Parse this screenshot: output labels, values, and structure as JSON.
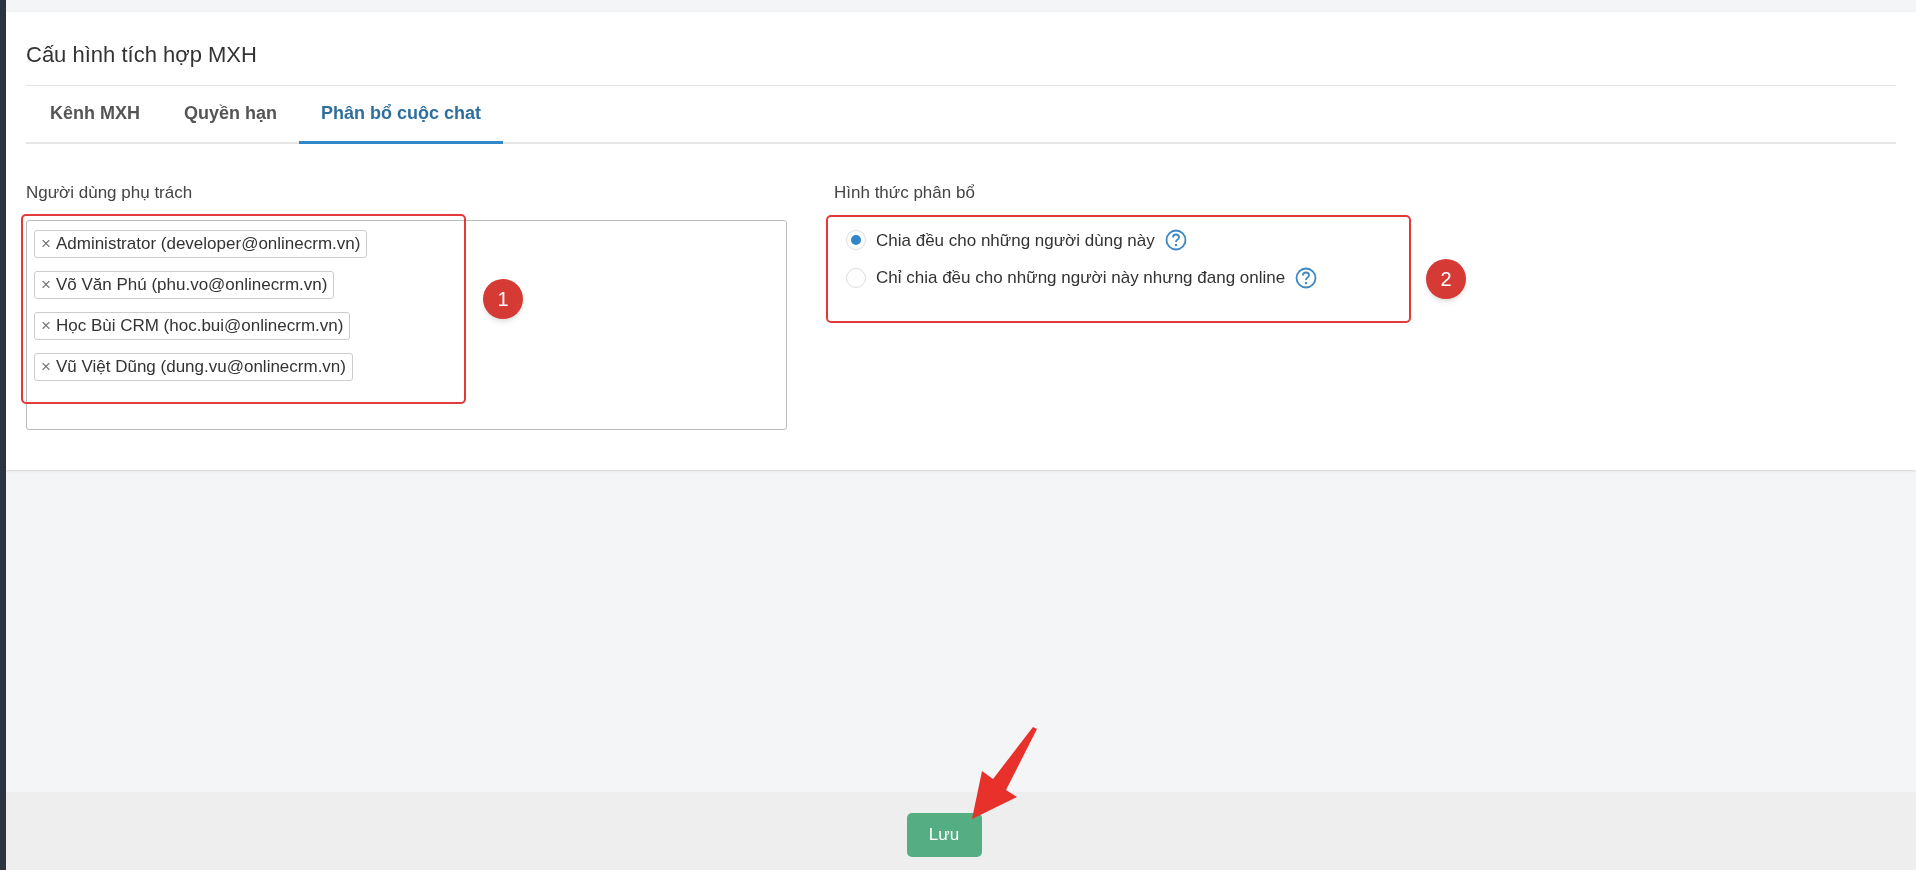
{
  "page": {
    "title": "Cấu hình tích hợp MXH"
  },
  "tabs": [
    {
      "label": "Kênh MXH",
      "selected": false
    },
    {
      "label": "Quyền hạn",
      "selected": false
    },
    {
      "label": "Phân bổ cuộc chat",
      "selected": true
    }
  ],
  "assigned_users": {
    "label": "Người dùng phụ trách",
    "tags": [
      {
        "remove": "×",
        "text": "Administrator (developer@onlinecrm.vn)"
      },
      {
        "remove": "×",
        "text": "Võ Văn Phú (phu.vo@onlinecrm.vn)"
      },
      {
        "remove": "×",
        "text": "Học Bùi CRM (hoc.bui@onlinecrm.vn)"
      },
      {
        "remove": "×",
        "text": "Vũ Việt Dũng (dung.vu@onlinecrm.vn)"
      }
    ]
  },
  "distribution": {
    "label": "Hình thức phân bổ",
    "options": [
      {
        "label": "Chia đều cho những người dùng này",
        "selected": true
      },
      {
        "label": "Chỉ chia đều cho những người này nhưng đang online",
        "selected": false
      }
    ]
  },
  "annotations": [
    {
      "label": "1"
    },
    {
      "label": "2"
    }
  ],
  "footer": {
    "save_button": "Lưu"
  }
}
